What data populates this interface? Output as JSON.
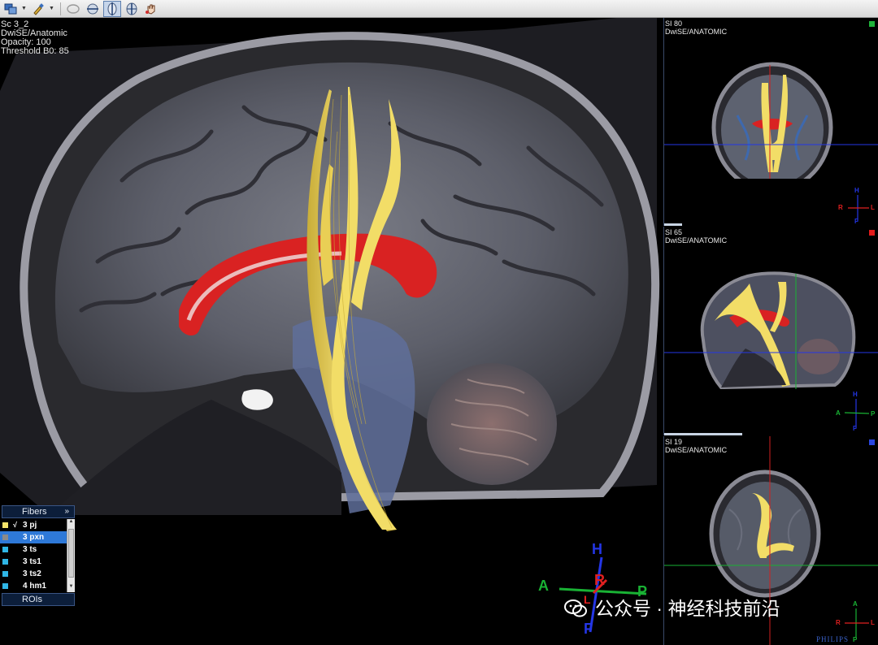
{
  "toolbar": {
    "buttons": [
      {
        "icon": "layout-icon"
      },
      {
        "icon": "paint-brush-icon"
      },
      {
        "icon": "roi-ellipse-icon"
      },
      {
        "icon": "coronal-plane-icon"
      },
      {
        "icon": "sagittal-plane-icon"
      },
      {
        "icon": "axial-plane-icon"
      },
      {
        "icon": "hand-pointer-icon"
      }
    ]
  },
  "main_view": {
    "series": "Sc 3_2",
    "sequence": "DwiSE/Anatomic",
    "opacity": "Opacity: 100",
    "threshold": "Threshold B0: 85",
    "orientation": {
      "top": "H",
      "bottom": "F",
      "left": "A",
      "right": "P",
      "center": "R",
      "center2": "L"
    }
  },
  "side_views": [
    {
      "slice": "SI 80",
      "sequence": "DwiSE/ANATOMIC",
      "marker_color": "#1fb33a",
      "orientation": {
        "top": "H",
        "bottom": "F",
        "left": "R",
        "right": "L"
      }
    },
    {
      "slice": "SI 65",
      "sequence": "DwiSE/ANATOMIC",
      "marker_color": "#e41b1b",
      "orientation": {
        "top": "H",
        "bottom": "F",
        "left": "A",
        "right": "P"
      }
    },
    {
      "slice": "SI 19",
      "sequence": "DwiSE/ANATOMIC",
      "marker_color": "#2a46e0",
      "orientation": {
        "top": "A",
        "bottom": "P",
        "left": "R",
        "right": "L"
      }
    }
  ],
  "fibers_panel": {
    "title": "Fibers",
    "expand": "»",
    "items": [
      {
        "label": "3 pj",
        "color": "#f3e36a",
        "checked": true,
        "check": "√",
        "selected": false
      },
      {
        "label": "3 pxn",
        "color": "#8a8a8a",
        "checked": false,
        "check": "",
        "selected": true
      },
      {
        "label": "3 ts",
        "color": "#2fb6e6",
        "checked": false,
        "check": "",
        "selected": false
      },
      {
        "label": "3 ts1",
        "color": "#2fb6e6",
        "checked": false,
        "check": "",
        "selected": false
      },
      {
        "label": "3 ts2",
        "color": "#2fb6e6",
        "checked": false,
        "check": "",
        "selected": false
      },
      {
        "label": "4 hm1",
        "color": "#2fb6e6",
        "checked": false,
        "check": "",
        "selected": false
      }
    ],
    "rois_label": "ROIs"
  },
  "watermark": "公众号 · 神经科技前沿",
  "vendor": "PHILIPS",
  "colors": {
    "fiber": "#f2dd67",
    "accent": "#2e79d8",
    "panel_bg": "#0c1e3a"
  }
}
